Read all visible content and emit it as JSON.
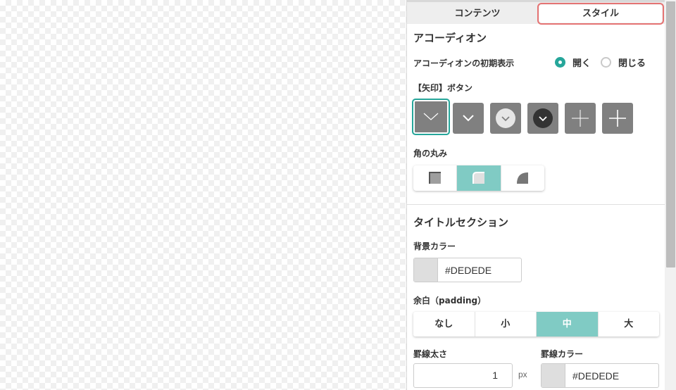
{
  "tabs": [
    {
      "label": "コンテンツ",
      "active": false
    },
    {
      "label": "スタイル",
      "active": true
    }
  ],
  "accordion": {
    "title": "アコーディオン",
    "initial_display_label": "アコーディオンの初期表示",
    "options": [
      {
        "label": "開く",
        "checked": true
      },
      {
        "label": "閉じる",
        "checked": false
      }
    ],
    "arrow_button_label": "【矢印】ボタン",
    "arrow_buttons": [
      {
        "icon": "chevron-down-thin-icon",
        "selected": true
      },
      {
        "icon": "chevron-down-icon",
        "selected": false
      },
      {
        "icon": "chevron-circle-light-icon",
        "selected": false
      },
      {
        "icon": "chevron-circle-dark-icon",
        "selected": false
      },
      {
        "icon": "plus-thin-icon",
        "selected": false
      },
      {
        "icon": "plus-icon",
        "selected": false
      }
    ],
    "corner_label": "角の丸み",
    "corner_options": [
      {
        "icon": "corner-square-icon",
        "active": false
      },
      {
        "icon": "corner-rounded-icon",
        "active": true
      },
      {
        "icon": "corner-round-icon",
        "active": false
      }
    ]
  },
  "title_section": {
    "title": "タイトルセクション",
    "bg_color_label": "背景カラー",
    "bg_color": "#DEDEDE",
    "padding_label": "余白（padding）",
    "padding_options": [
      {
        "label": "なし",
        "active": false
      },
      {
        "label": "小",
        "active": false
      },
      {
        "label": "中",
        "active": true
      },
      {
        "label": "大",
        "active": false
      }
    ],
    "border_width_label": "罫線太さ",
    "border_width": "1",
    "border_width_unit": "px",
    "border_color_label": "罫線カラー",
    "border_color": "#DEDEDE"
  },
  "colors": {
    "accent": "#26a69a",
    "accent_light": "#80cbc4",
    "tab_highlight": "#e57373",
    "button_gray": "#808080"
  }
}
